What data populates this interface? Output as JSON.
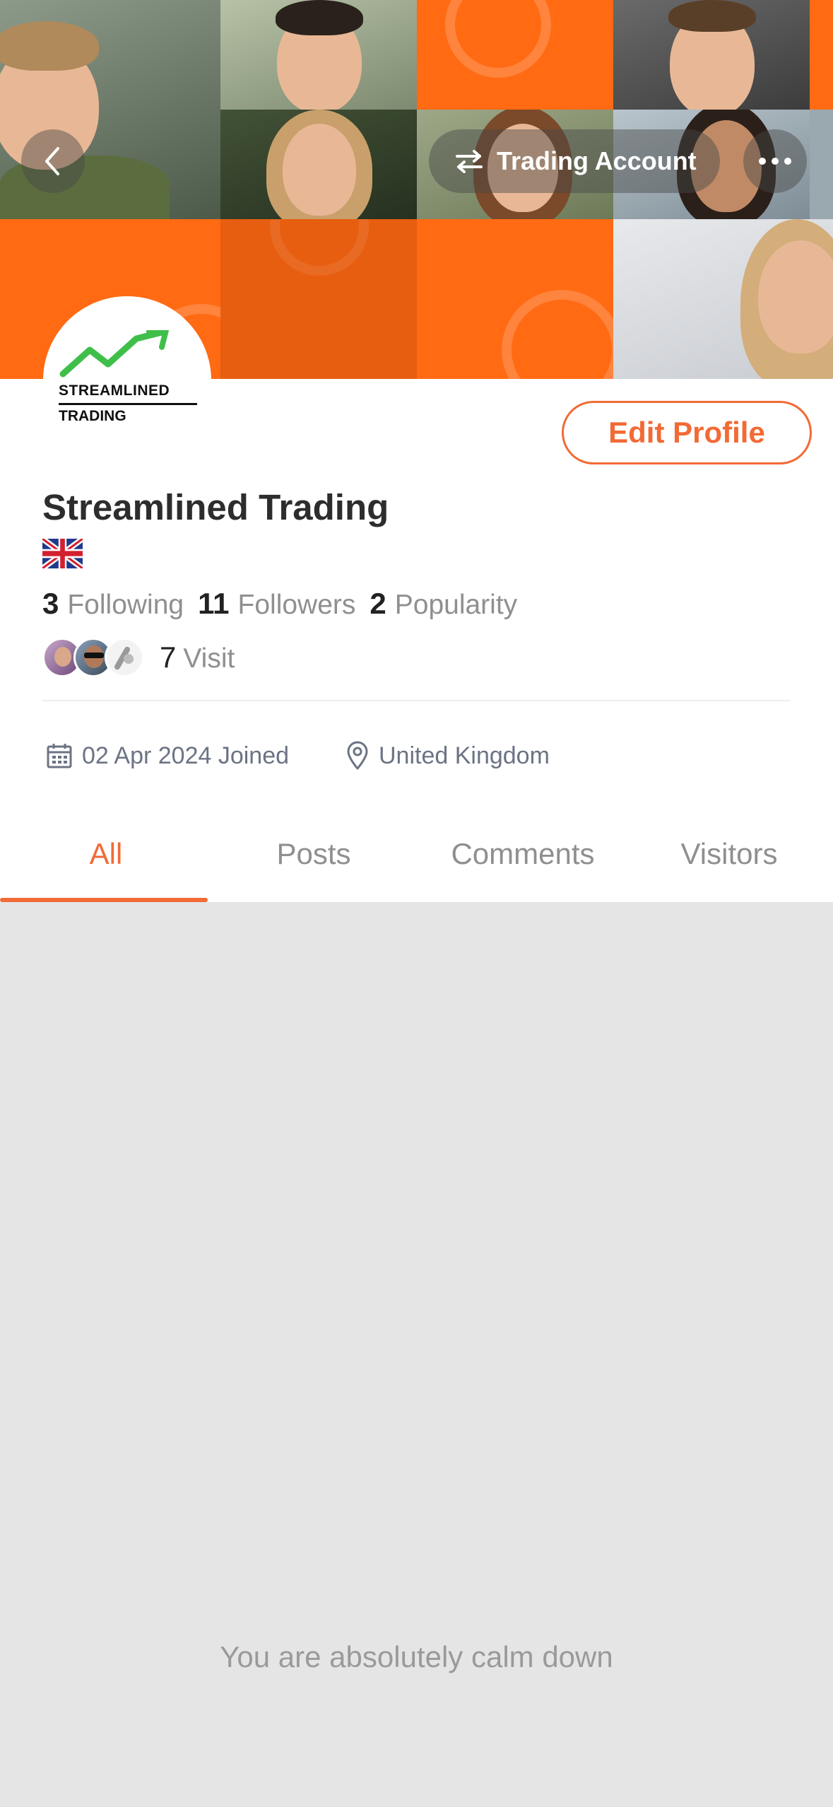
{
  "header": {
    "account_switch_label": "Trading Account"
  },
  "profile": {
    "logo_text_line1": "STREAMLINED",
    "logo_text_line2": "TRADING",
    "name": "Streamlined Trading",
    "edit_button_label": "Edit Profile",
    "stats": [
      {
        "value": "3",
        "label": "Following"
      },
      {
        "value": "11",
        "label": "Followers"
      },
      {
        "value": "2",
        "label": "Popularity"
      }
    ],
    "visits": {
      "count": "7",
      "label": "Visit"
    },
    "joined": "02 Apr 2024 Joined",
    "location": "United Kingdom"
  },
  "tabs": [
    {
      "label": "All",
      "active": true
    },
    {
      "label": "Posts",
      "active": false
    },
    {
      "label": "Comments",
      "active": false
    },
    {
      "label": "Visitors",
      "active": false
    }
  ],
  "empty_message": "You are absolutely calm down",
  "colors": {
    "accent": "#f26a35",
    "cover_orange": "#ff6a13",
    "meta_text": "#6b7384",
    "muted_text": "#8f8f8f",
    "content_bg": "#e5e5e5"
  },
  "icons": {
    "back": "chevron-left-icon",
    "switch": "swap-arrows-icon",
    "more": "more-dots-icon",
    "calendar": "calendar-icon",
    "location": "map-pin-icon",
    "flag": "uk-flag-icon"
  }
}
